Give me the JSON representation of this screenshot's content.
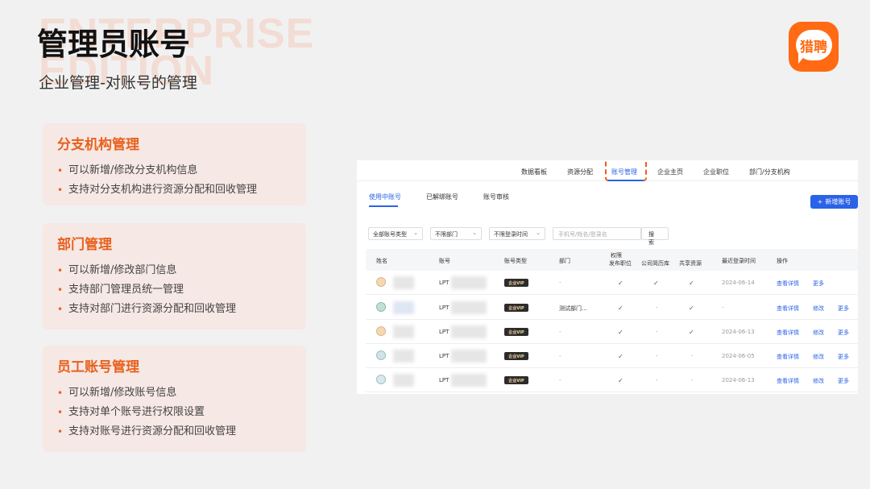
{
  "bg_text": {
    "line1": "ENTERPRISE",
    "line2": "EDITION"
  },
  "title": "管理员账号",
  "subtitle": "企业管理-对账号的管理",
  "logo": {
    "text": "猎聘",
    "color": "#ff6a13"
  },
  "cards": [
    {
      "title": "分支机构管理",
      "items": [
        "可以新增/修改分支机构信息",
        "支持对分支机构进行资源分配和回收管理"
      ]
    },
    {
      "title": "部门管理",
      "items": [
        "可以新增/修改部门信息",
        "支持部门管理员统一管理",
        "支持对部门进行资源分配和回收管理"
      ]
    },
    {
      "title": "员工账号管理",
      "items": [
        "可以新增/修改账号信息",
        "支持对单个账号进行权限设置",
        "支持对账号进行资源分配和回收管理"
      ]
    }
  ],
  "nav": {
    "items": [
      "数据看板",
      "资源分配",
      "账号管理",
      "企业主页",
      "企业职位",
      "部门/分支机构"
    ],
    "active": "账号管理"
  },
  "subtabs": [
    "使用中账号",
    "已解绑账号",
    "账号审核"
  ],
  "new_button": {
    "icon": "plus-icon",
    "label": "新增账号"
  },
  "filters": {
    "account_type": "全部账号类型",
    "department": "不限部门",
    "login_time": "不限登录时间",
    "search_placeholder": "手机号/姓名/登录名",
    "search_button": "搜 索"
  },
  "table": {
    "headers": {
      "name": "姓名",
      "account": "账号",
      "type": "账号类型",
      "dept": "部门",
      "perm": "权限",
      "post_job": "发布职位",
      "resume_lib": "公司简历库",
      "shared": "共享资源",
      "last_login": "最近登录时间",
      "ops": "操作"
    },
    "rows": [
      {
        "name": "",
        "account": "LPT",
        "vip": "企业VIP",
        "dept": "-",
        "post_job": "✓",
        "resume_lib": "✓",
        "shared": "✓",
        "last_login": "2024-06-14",
        "ops": [
          "查看详情",
          "更多"
        ]
      },
      {
        "name": "",
        "account": "LPT",
        "vip": "企业VIP",
        "dept": "测试部门...",
        "post_job": "✓",
        "resume_lib": "-",
        "shared": "✓",
        "last_login": "-",
        "ops": [
          "查看详情",
          "修改",
          "更多"
        ]
      },
      {
        "name": "",
        "account": "LPT",
        "vip": "企业VIP",
        "dept": "-",
        "post_job": "✓",
        "resume_lib": "-",
        "shared": "✓",
        "last_login": "2024-06-13",
        "ops": [
          "查看详情",
          "修改",
          "更多"
        ]
      },
      {
        "name": "",
        "account": "LPT",
        "vip": "企业VIP",
        "dept": "-",
        "post_job": "✓",
        "resume_lib": "-",
        "shared": "-",
        "last_login": "2024-06-05",
        "ops": [
          "查看详情",
          "修改",
          "更多"
        ]
      },
      {
        "name": "",
        "account": "LPT",
        "vip": "企业VIP",
        "dept": "-",
        "post_job": "✓",
        "resume_lib": "-",
        "shared": "-",
        "last_login": "2024-06-13",
        "ops": [
          "查看详情",
          "修改",
          "更多"
        ]
      }
    ]
  }
}
